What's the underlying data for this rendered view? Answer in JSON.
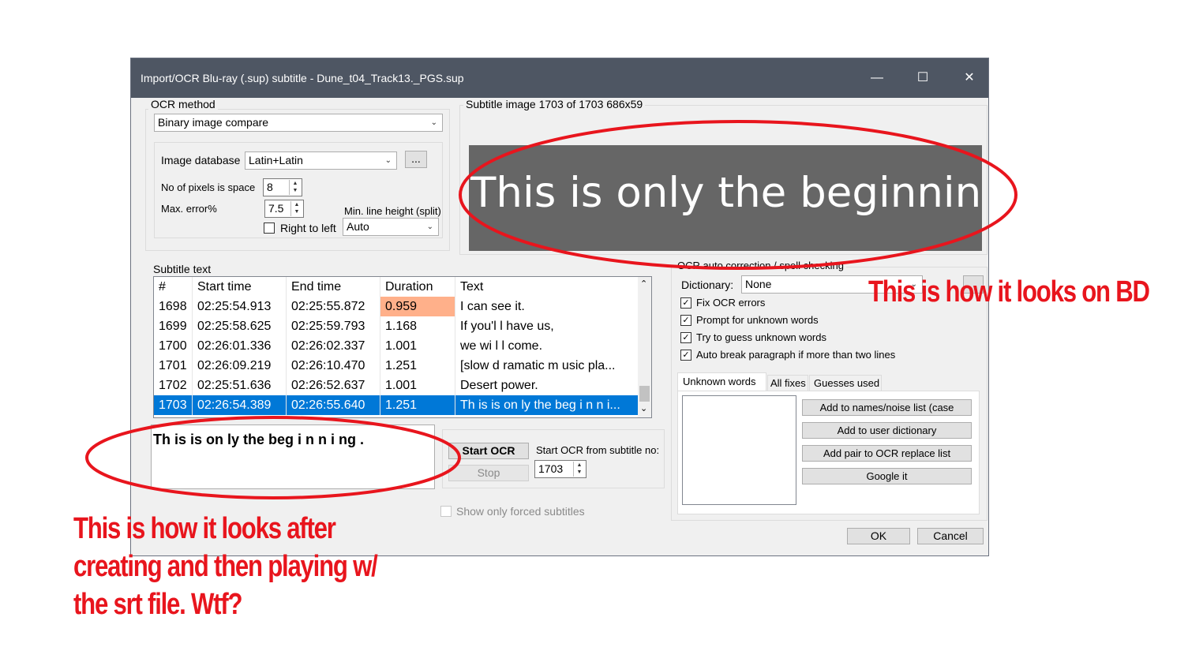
{
  "window": {
    "title": "Import/OCR Blu-ray (.sup) subtitle - Dune_t04_Track13._PGS.sup",
    "minimize_glyph": "—",
    "maximize_glyph": "☐",
    "close_glyph": "✕"
  },
  "ocr_method": {
    "group_label": "OCR method",
    "method_value": "Binary image compare",
    "image_database_label": "Image database",
    "image_database_value": "Latin+Latin",
    "browse_button": "...",
    "pixels_space_label": "No of pixels is space",
    "pixels_space_value": "8",
    "max_error_label": "Max. error%",
    "max_error_value": "7.5",
    "min_line_height_label": "Min. line height (split)",
    "min_line_height_value": "Auto",
    "right_to_left_label": "Right to left",
    "right_to_left_checked": false
  },
  "subtitle_image": {
    "label": "Subtitle image 1703 of 1703   686x59",
    "image_text": "This is only the beginning.",
    "image_bg": "#666666"
  },
  "subtitle_text": {
    "label": "Subtitle text",
    "columns": [
      "#",
      "Start time",
      "End time",
      "Duration",
      "Text"
    ],
    "rows": [
      [
        "1698",
        "02:25:54.913",
        "02:25:55.872",
        "0.959",
        "I can see it."
      ],
      [
        "1699",
        "02:25:58.625",
        "02:25:59.793",
        "1.168",
        "If you'l l have us,"
      ],
      [
        "1700",
        "02:26:01.336",
        "02:26:02.337",
        "1.001",
        "we wi l l come."
      ],
      [
        "1701",
        "02:26:09.219",
        "02:26:10.470",
        "1.251",
        "[slow d ramatic m usic pla..."
      ],
      [
        "1702",
        "02:25:51.636",
        "02:26:52.637",
        "1.001",
        "Desert power."
      ],
      [
        "1703",
        "02:26:54.389",
        "02:26:55.640",
        "1.251",
        "Th is is on ly the beg i n n i..."
      ]
    ],
    "selected_row": 5,
    "edit_text": "Th is is on ly the beg i n n i ng ."
  },
  "ocr_controls": {
    "start_ocr": "Start OCR",
    "stop": "Stop",
    "start_from_label": "Start OCR from subtitle no:",
    "start_from_value": "1703",
    "show_forced_label": "Show only forced subtitles"
  },
  "auto_correction": {
    "group_label": "OCR auto correction / spell checking",
    "dictionary_label": "Dictionary:",
    "dictionary_value": "None",
    "checks": [
      {
        "label": "Fix OCR errors",
        "checked": true
      },
      {
        "label": "Prompt for unknown words",
        "checked": true
      },
      {
        "label": "Try to guess unknown words",
        "checked": true
      },
      {
        "label": "Auto break paragraph if more than two lines",
        "checked": true
      }
    ],
    "tabs": [
      "Unknown words",
      "All fixes",
      "Guesses used"
    ],
    "buttons": [
      "Add to names/noise list (case",
      "Add to user dictionary",
      "Add pair to OCR replace list",
      "Google it"
    ]
  },
  "dialog_buttons": {
    "ok": "OK",
    "cancel": "Cancel"
  },
  "annotations": {
    "bd_note": "This is how it looks on BD",
    "srt_note_line1": "This is how it looks after",
    "srt_note_line2": "creating and then playing w/",
    "srt_note_line3": "the srt file.  Wtf?",
    "color": "#e8151d"
  }
}
